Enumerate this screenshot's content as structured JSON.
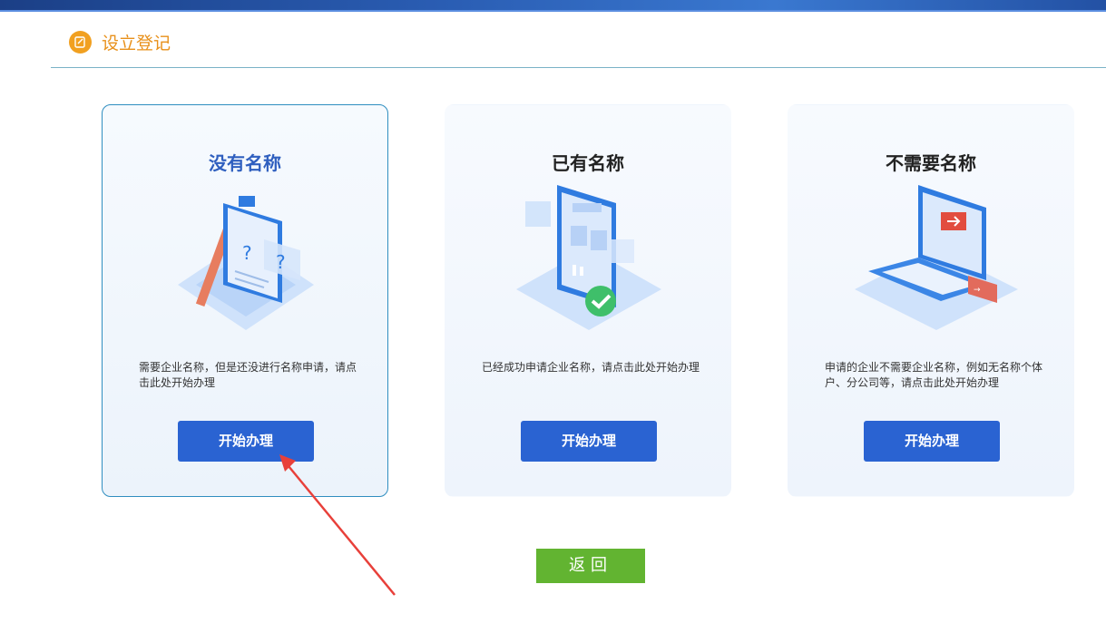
{
  "header": {
    "title": "设立登记",
    "icon": "edit-icon",
    "accent_color": "#e8901a"
  },
  "cards": [
    {
      "title": "没有名称",
      "illustration": "blank-document-question-icon",
      "description": "需要企业名称，但是还没进行名称申请，请点击此处开始办理",
      "button_label": "开始办理",
      "selected": true
    },
    {
      "title": "已有名称",
      "illustration": "phone-checkmark-icon",
      "description": "已经成功申请企业名称，请点击此处开始办理",
      "button_label": "开始办理",
      "selected": false
    },
    {
      "title": "不需要名称",
      "illustration": "laptop-next-step-icon",
      "description": "申请的企业不需要企业名称，例如无名称个体户、分公司等，请点击此处开始办理",
      "button_label": "开始办理",
      "selected": false
    }
  ],
  "back_button": {
    "label": "返回"
  },
  "colors": {
    "primary_button": "#2a63d2",
    "back_button": "#62b431",
    "annotation_arrow": "#e8403a"
  }
}
